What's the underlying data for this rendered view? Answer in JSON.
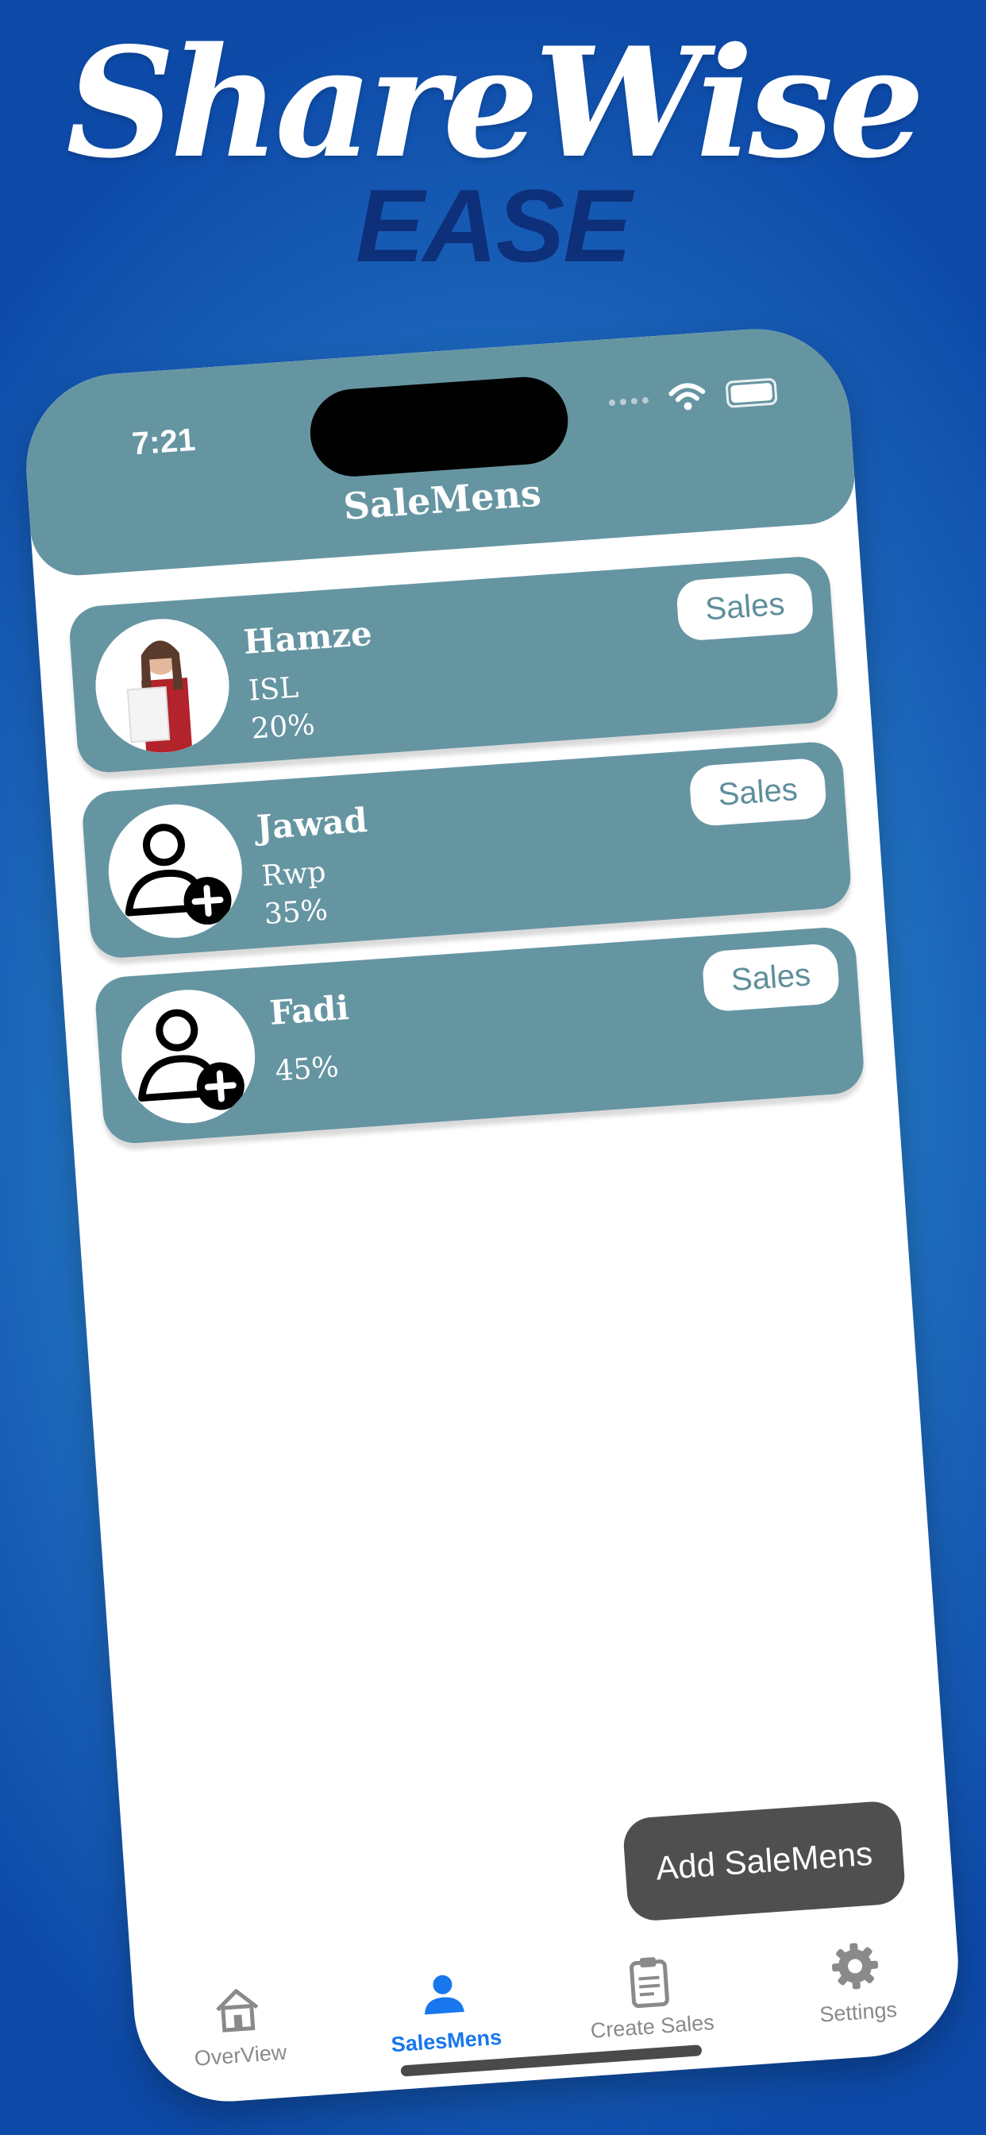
{
  "brand": {
    "title": "ShareWise",
    "subtitle": "EASE"
  },
  "status_bar": {
    "time": "7:21"
  },
  "header": {
    "title": "SaleMens"
  },
  "salesmen": [
    {
      "name": "Hamze",
      "city": "ISL",
      "percent": "20%",
      "button": "Sales",
      "avatar": "photo"
    },
    {
      "name": "Jawad",
      "city": "Rwp",
      "percent": "35%",
      "button": "Sales",
      "avatar": "add-user-icon"
    },
    {
      "name": "Fadi",
      "city": "",
      "percent": "45%",
      "button": "Sales",
      "avatar": "add-user-icon"
    }
  ],
  "add_button": "Add SaleMens",
  "tabs": [
    {
      "label": "OverView",
      "icon": "home-icon",
      "active": false
    },
    {
      "label": "SalesMens",
      "icon": "person-icon",
      "active": true
    },
    {
      "label": "Create Sales",
      "icon": "clipboard-icon",
      "active": false
    },
    {
      "label": "Settings",
      "icon": "gear-icon",
      "active": false
    }
  ],
  "colors": {
    "accent": "#1877ee",
    "card": "#6695a2",
    "button_dark": "#4f4f4f"
  }
}
